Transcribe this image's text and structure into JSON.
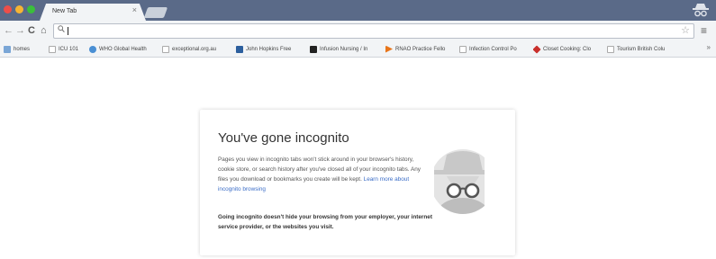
{
  "window": {
    "tab_title": "New Tab",
    "tab_close": "×"
  },
  "toolbar": {
    "back_icon": "←",
    "forward_icon": "→",
    "reload_icon": "C",
    "home_icon": "⌂",
    "omnibox_icon": "search-icon",
    "omnibox_value": "",
    "star_icon": "☆",
    "menu_icon": "≡"
  },
  "bookmarks": {
    "items": [
      {
        "label": "homes",
        "icon": "folder"
      },
      {
        "label": "ICU 101",
        "icon": "page"
      },
      {
        "label": "WHO Global Health",
        "icon": "globe"
      },
      {
        "label": "exceptional.org.au",
        "icon": "page"
      },
      {
        "label": "John Hopkins Free",
        "icon": "jh"
      },
      {
        "label": "Infusion Nursing / In",
        "icon": "inf"
      },
      {
        "label": "RNAO Practice Fello",
        "icon": "rnao"
      },
      {
        "label": "Infection Control Po",
        "icon": "page"
      },
      {
        "label": "Closet Cooking: Clo",
        "icon": "cook"
      },
      {
        "label": "Tourism British Colu",
        "icon": "page"
      }
    ],
    "more": "»"
  },
  "incognito": {
    "title": "You've gone incognito",
    "body": "Pages you view in incognito tabs won't stick around in your browser's history, cookie store, or search history after you've closed all of your incognito tabs. Any files you download or bookmarks you create will be kept.",
    "link": "Learn more about incognito browsing",
    "warning": "Going incognito doesn't hide your browsing from your employer, your internet service provider, or the websites you visit."
  },
  "colors": {
    "titlebar": "#5a6a88",
    "toolbar": "#f2f4f6",
    "link": "#3b6dc7"
  }
}
